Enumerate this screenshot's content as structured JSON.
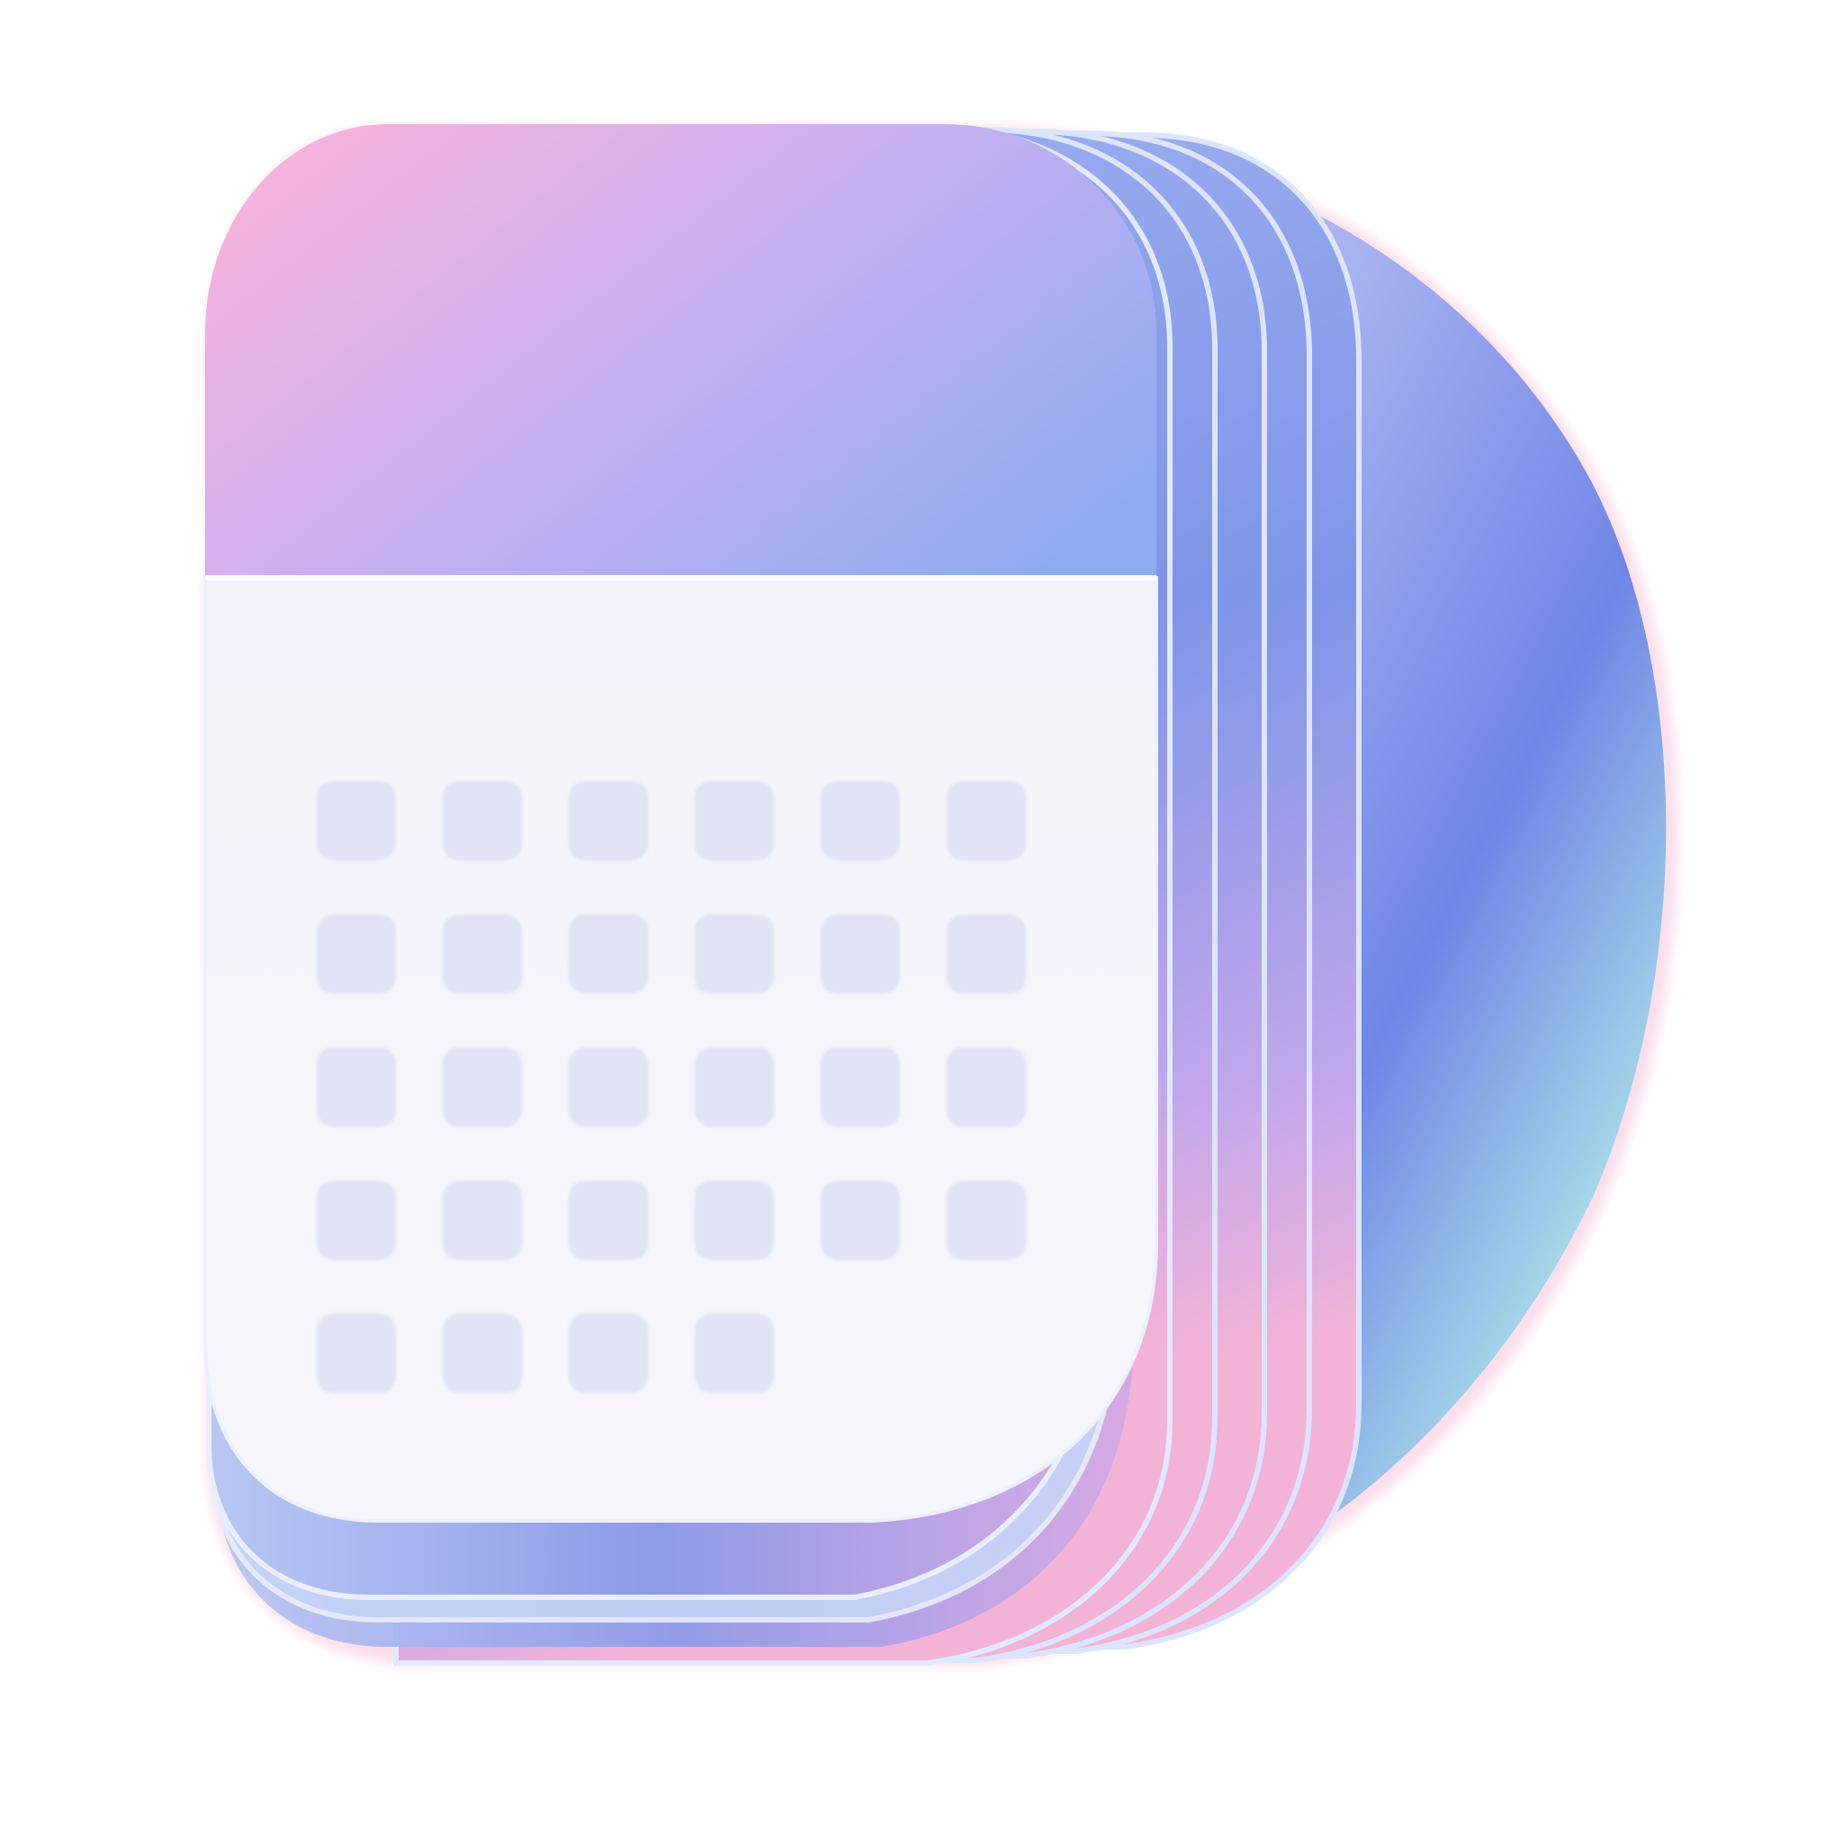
{
  "icon": {
    "name": "calendar-app-icon",
    "grid": {
      "rows": [
        6,
        6,
        6,
        6,
        4
      ]
    },
    "colors": {
      "accent_pink": "#F2B8E6",
      "accent_violet": "#BFA9F2",
      "accent_blue": "#8FA6F0",
      "deep_blue": "#6F86E6",
      "cyan_rim": "#A9DDE8",
      "page_face": "#F3F4FB",
      "cell": "#DCE1F2",
      "rim_pink": "#F6B6D0",
      "background": "#FFFFFF"
    }
  }
}
